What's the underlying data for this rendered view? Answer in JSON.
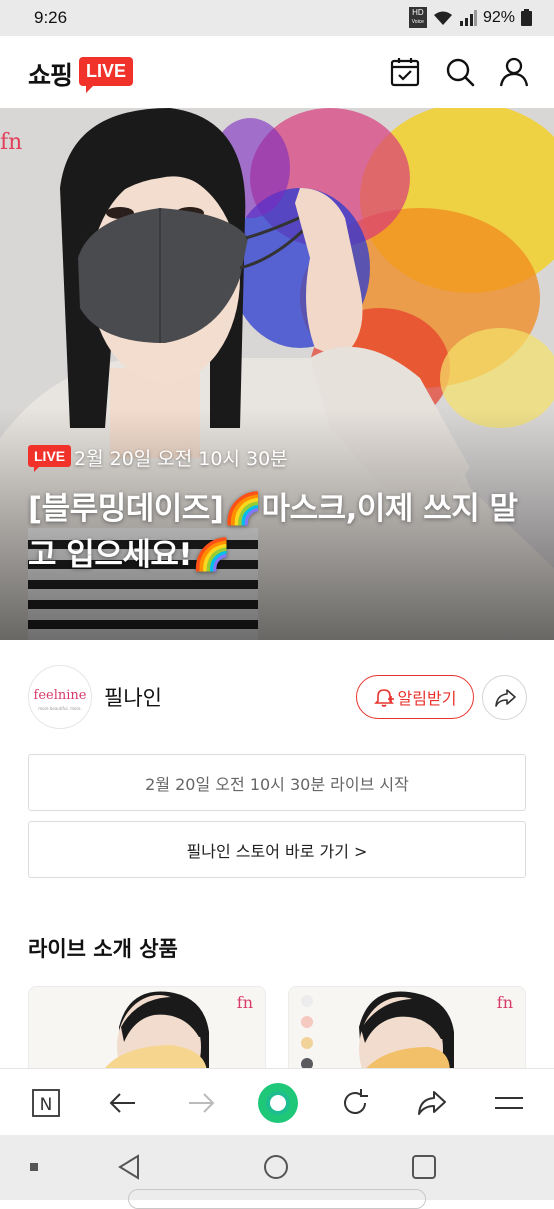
{
  "status": {
    "time": "9:26",
    "battery": "92%",
    "hd_label": "HD",
    "voice_label": "Voice"
  },
  "appbar": {
    "logo_text": "쇼핑",
    "logo_badge": "LIVE"
  },
  "hero": {
    "brand_mark": "fn",
    "live_tag": "LIVE",
    "datetime": "2월 20일 오전 10시 30분",
    "title": "[블루밍데이즈]🌈마스크,이제 쓰지 말고 입으세요!🌈"
  },
  "seller": {
    "avatar_text": "feelnine",
    "avatar_sub": "more beautiful. more.",
    "name": "필나인",
    "alarm_label": "알림받기"
  },
  "schedule_text": "2월 20일 오전 10시 30분 라이브 시작",
  "store_link": "필나인 스토어 바로 가기 >",
  "section_title": "라이브 소개 상품",
  "cards": [
    {
      "brand": "fn"
    },
    {
      "brand": "fn"
    }
  ],
  "browser": {
    "home_icon_letter": "N"
  },
  "colors": {
    "accent_red": "#f0322b",
    "green_button": "#1ec878"
  }
}
